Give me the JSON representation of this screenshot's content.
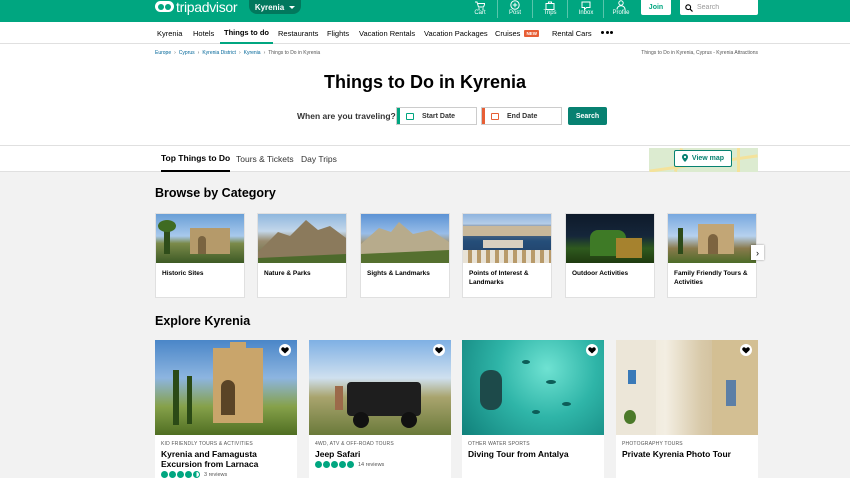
{
  "header": {
    "logo_text": "tripadvisor",
    "location": "Kyrenia",
    "nav": [
      {
        "label": "Cart",
        "icon": "cart-icon"
      },
      {
        "label": "Post",
        "icon": "plus-circle-icon"
      },
      {
        "label": "Trips",
        "icon": "suitcase-icon"
      },
      {
        "label": "Inbox",
        "icon": "inbox-icon"
      },
      {
        "label": "Profile",
        "icon": "person-icon"
      }
    ],
    "join_label": "Join",
    "search_placeholder": "Search",
    "brand_color": "#00a680"
  },
  "subnav": {
    "items": [
      "Kyrenia",
      "Hotels",
      "Things to do",
      "Restaurants",
      "Flights",
      "Vacation Rentals",
      "Vacation Packages",
      "Cruises",
      "Rental Cars"
    ],
    "new_badge": "NEW",
    "active": "Things to do"
  },
  "breadcrumb": {
    "items": [
      "Europe",
      "Cyprus",
      "Kyrenia District",
      "Kyrenia",
      "Things to Do in Kyrenia"
    ],
    "right_text": "Things to Do in Kyrenia, Cyprus - Kyrenia Attractions"
  },
  "hero": {
    "title": "Things to Do in Kyrenia",
    "travel_label": "When are you traveling?",
    "start_date": "Start Date",
    "end_date": "End Date",
    "search_label": "Search"
  },
  "tabs": {
    "items": [
      "Top Things to Do",
      "Tours & Tickets",
      "Day Trips"
    ],
    "active": "Top Things to Do",
    "view_map": "View map"
  },
  "browse": {
    "title": "Browse by Category",
    "categories": [
      {
        "label": "Historic Sites"
      },
      {
        "label": "Nature & Parks"
      },
      {
        "label": "Sights & Landmarks"
      },
      {
        "label": "Points of Interest & Landmarks"
      },
      {
        "label": "Outdoor Activities"
      },
      {
        "label": "Family Friendly Tours & Activities"
      }
    ]
  },
  "explore": {
    "title": "Explore Kyrenia",
    "cards": [
      {
        "category": "KID FRIENDLY TOURS & ACTIVITIES",
        "name": "Kyrenia and Famagusta Excursion from Larnaca",
        "rating": 4.5,
        "reviews": "3 reviews"
      },
      {
        "category": "4WD, ATV & OFF-ROAD TOURS",
        "name": "Jeep Safari",
        "rating": 5,
        "reviews": "14 reviews"
      },
      {
        "category": "OTHER WATER SPORTS",
        "name": "Diving Tour from Antalya"
      },
      {
        "category": "PHOTOGRAPHY TOURS",
        "name": "Private Kyrenia Photo Tour"
      }
    ]
  }
}
